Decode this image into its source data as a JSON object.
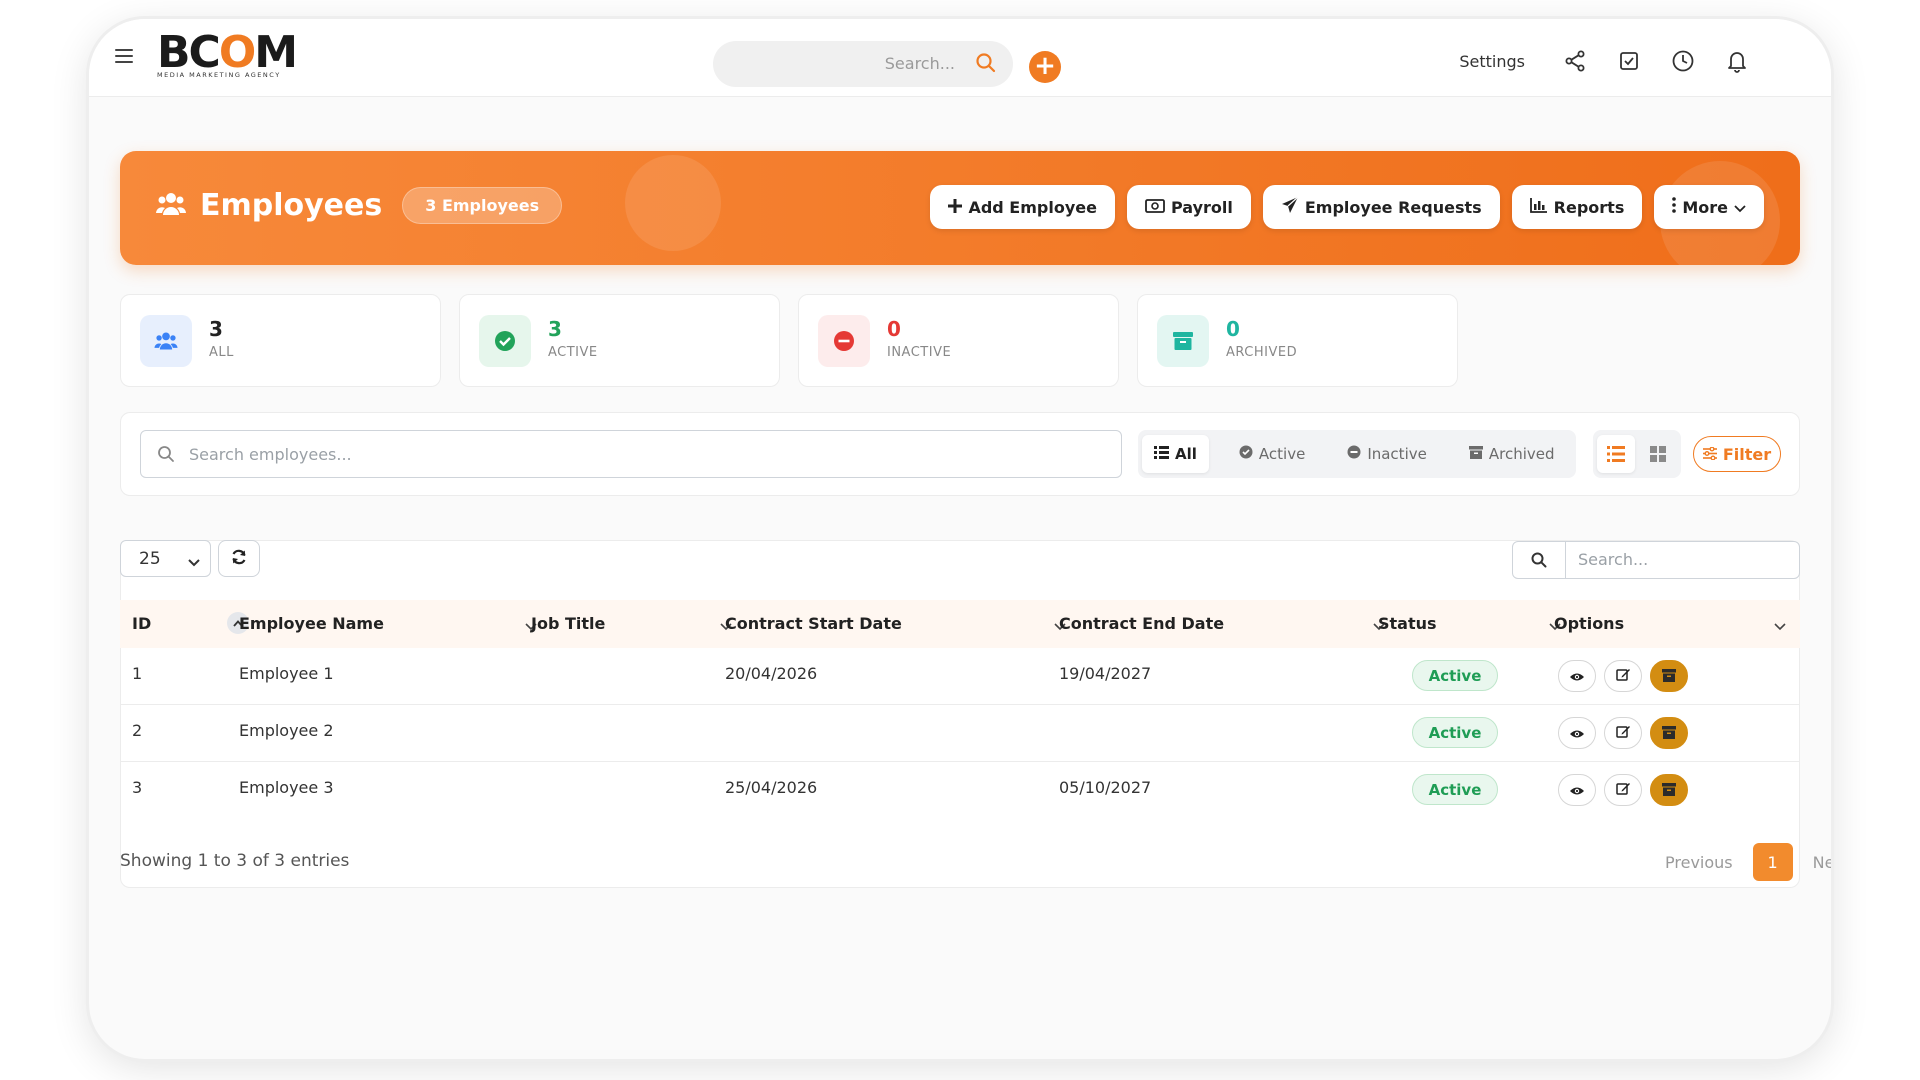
{
  "header": {
    "logo_text": "BCOM",
    "logo_tagline": "MEDIA MARKETING AGENCY",
    "search_placeholder": "Search...",
    "settings_label": "Settings"
  },
  "banner": {
    "title": "Employees",
    "count_label": "3 Employees",
    "actions": [
      "Add Employee",
      "Payroll",
      "Employee Requests",
      "Reports",
      "More"
    ]
  },
  "stats": [
    {
      "value": "3",
      "label": "ALL",
      "color": "#3b82f6"
    },
    {
      "value": "3",
      "label": "ACTIVE",
      "color": "#22a35a"
    },
    {
      "value": "0",
      "label": "INACTIVE",
      "color": "#e53935"
    },
    {
      "value": "0",
      "label": "ARCHIVED",
      "color": "#1fb5a0"
    }
  ],
  "filters": {
    "search_placeholder": "Search employees...",
    "tabs": [
      "All",
      "Active",
      "Inactive",
      "Archived"
    ],
    "active_tab": "All",
    "filter_label": "Filter"
  },
  "table": {
    "page_size": "25",
    "search_placeholder": "Search...",
    "columns": [
      "ID",
      "Employee Name",
      "Job Title",
      "Contract Start Date",
      "Contract End Date",
      "Status",
      "Options"
    ],
    "rows": [
      {
        "id": "1",
        "name": "Employee 1",
        "job": "",
        "start": "20/04/2026",
        "end": "19/04/2027",
        "status": "Active"
      },
      {
        "id": "2",
        "name": "Employee 2",
        "job": "",
        "start": "",
        "end": "",
        "status": "Active"
      },
      {
        "id": "3",
        "name": "Employee 3",
        "job": "",
        "start": "25/04/2026",
        "end": "05/10/2027",
        "status": "Active"
      }
    ],
    "info": "Showing 1 to 3 of 3 entries",
    "pagination": {
      "previous": "Previous",
      "current": "1",
      "next": "Next"
    }
  },
  "colors": {
    "accent": "#f07b22",
    "archive": "#d38d12",
    "active_status": "#1f9d55"
  }
}
